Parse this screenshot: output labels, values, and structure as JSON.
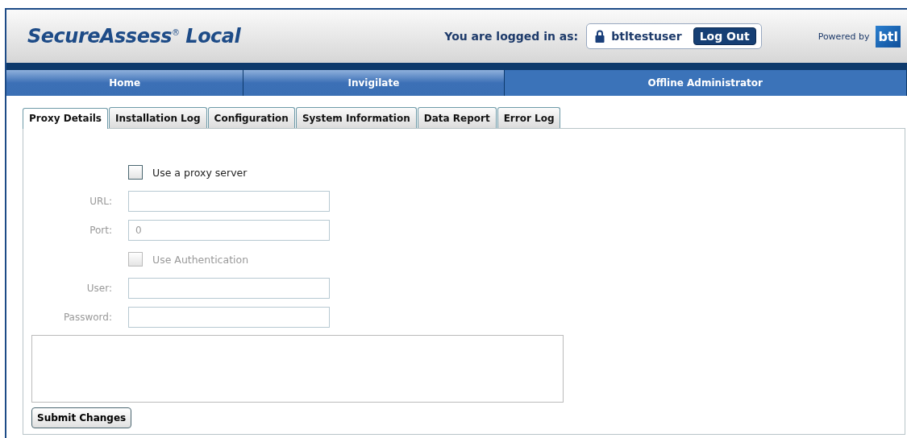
{
  "header": {
    "title": "SecureAssess$^{®}$ Local",
    "logged_in_label": "You are logged in as:",
    "username": "btltestuser",
    "logout": "Log Out",
    "powered_by": "Powered by",
    "logo": "btl"
  },
  "nav": [
    {
      "label": "Home",
      "selected": false
    },
    {
      "label": "Invigilate",
      "selected": false
    },
    {
      "label": "Offline Administrator",
      "selected": true
    }
  ],
  "tabs": [
    {
      "label": "Proxy Details",
      "selected": true
    },
    {
      "label": "Installation Log",
      "selected": false
    },
    {
      "label": "Configuration",
      "selected": false
    },
    {
      "label": "System Information",
      "selected": false
    },
    {
      "label": "Data Report",
      "selected": false
    },
    {
      "label": "Error Log",
      "selected": false
    }
  ],
  "form": [
    {
      "kind": "checkbox",
      "label": "Use a proxy server",
      "checked": false,
      "disabled": false
    },
    {
      "kind": "field",
      "label": "URL:",
      "disabled": true
    },
    {
      "kind": "field",
      "label": "Port:",
      "value": "0",
      "disabled": true
    },
    {
      "kind": "checkbox",
      "label": "Use Authentication",
      "checked": false,
      "disabled": true
    },
    {
      "kind": "field",
      "label": "User:",
      "disabled": true
    },
    {
      "kind": "field",
      "label": "Password:",
      "disabled": true
    }
  ],
  "submit": "Submit Changes"
}
